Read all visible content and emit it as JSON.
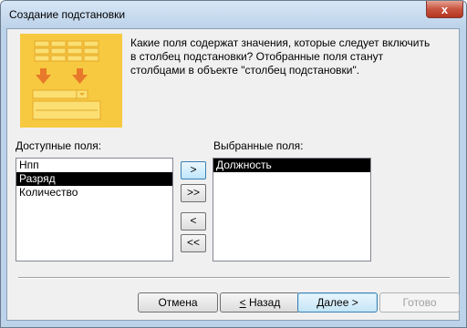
{
  "window": {
    "title": "Создание подстановки",
    "close_glyph": "x"
  },
  "description": "Какие поля содержат значения, которые следует включить в столбец подстановки? Отобранные поля станут столбцами в объекте \"столбец подстановки\".",
  "available": {
    "label": "Доступные поля:",
    "items": [
      "Нпп",
      "Разряд",
      "Количество"
    ],
    "selected_index": 1
  },
  "selected": {
    "label": "Выбранные поля:",
    "items": [
      "Должность"
    ],
    "selected_index": 0
  },
  "move_buttons": {
    "add_one": ">",
    "add_all": ">>",
    "remove_one": "<",
    "remove_all": "<<"
  },
  "footer": {
    "cancel": "Отмена",
    "back_accel": "<",
    "back_rest": " Назад",
    "next_accel": "Д",
    "next_rest": "алее >",
    "finish": "Готово"
  },
  "colors": {
    "illustration": "#f7c940",
    "accent": "#3c7fb1"
  }
}
